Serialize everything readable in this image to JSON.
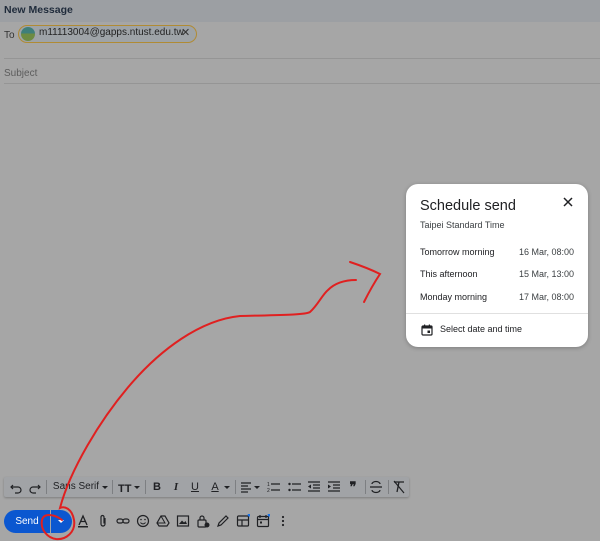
{
  "window": {
    "title": "New Message"
  },
  "to": {
    "label": "To",
    "recipient": "m11113004@gapps.ntust.edu.tw",
    "remove_glyph": "✕"
  },
  "subject": {
    "placeholder": "Subject"
  },
  "schedule_popup": {
    "title": "Schedule send",
    "timezone": "Taipei Standard Time",
    "options": [
      {
        "label": "Tomorrow morning",
        "time": "16 Mar, 08:00"
      },
      {
        "label": "This afternoon",
        "time": "15 Mar, 13:00"
      },
      {
        "label": "Monday morning",
        "time": "17 Mar, 08:00"
      }
    ],
    "select_label": "Select date and time",
    "close_icon": "close-icon",
    "calendar_icon": "calendar-icon"
  },
  "format_bar": {
    "font": "Sans Serif",
    "bold": "B",
    "italic": "I",
    "underline": "U",
    "text_color": "A",
    "quote": "❞",
    "icons": [
      "undo-icon",
      "redo-icon",
      "font-size-icon",
      "align-icon",
      "numbered-list-icon",
      "bulleted-list-icon",
      "indent-less-icon",
      "indent-more-icon",
      "quote-icon",
      "strikethrough-icon",
      "remove-formatting-icon"
    ]
  },
  "bottom_bar": {
    "send_label": "Send",
    "icons": [
      "formatting-options-icon",
      "attach-icon",
      "link-icon",
      "emoji-icon",
      "drive-icon",
      "photo-icon",
      "confidential-mode-icon",
      "signature-icon",
      "template-icon",
      "calendar-icon",
      "more-options-icon"
    ]
  },
  "colors": {
    "send_blue": "#0b57d0",
    "annotation_red": "#e02020",
    "overlay_gray": "#a6a6a6",
    "chip_border": "#b08b34"
  }
}
